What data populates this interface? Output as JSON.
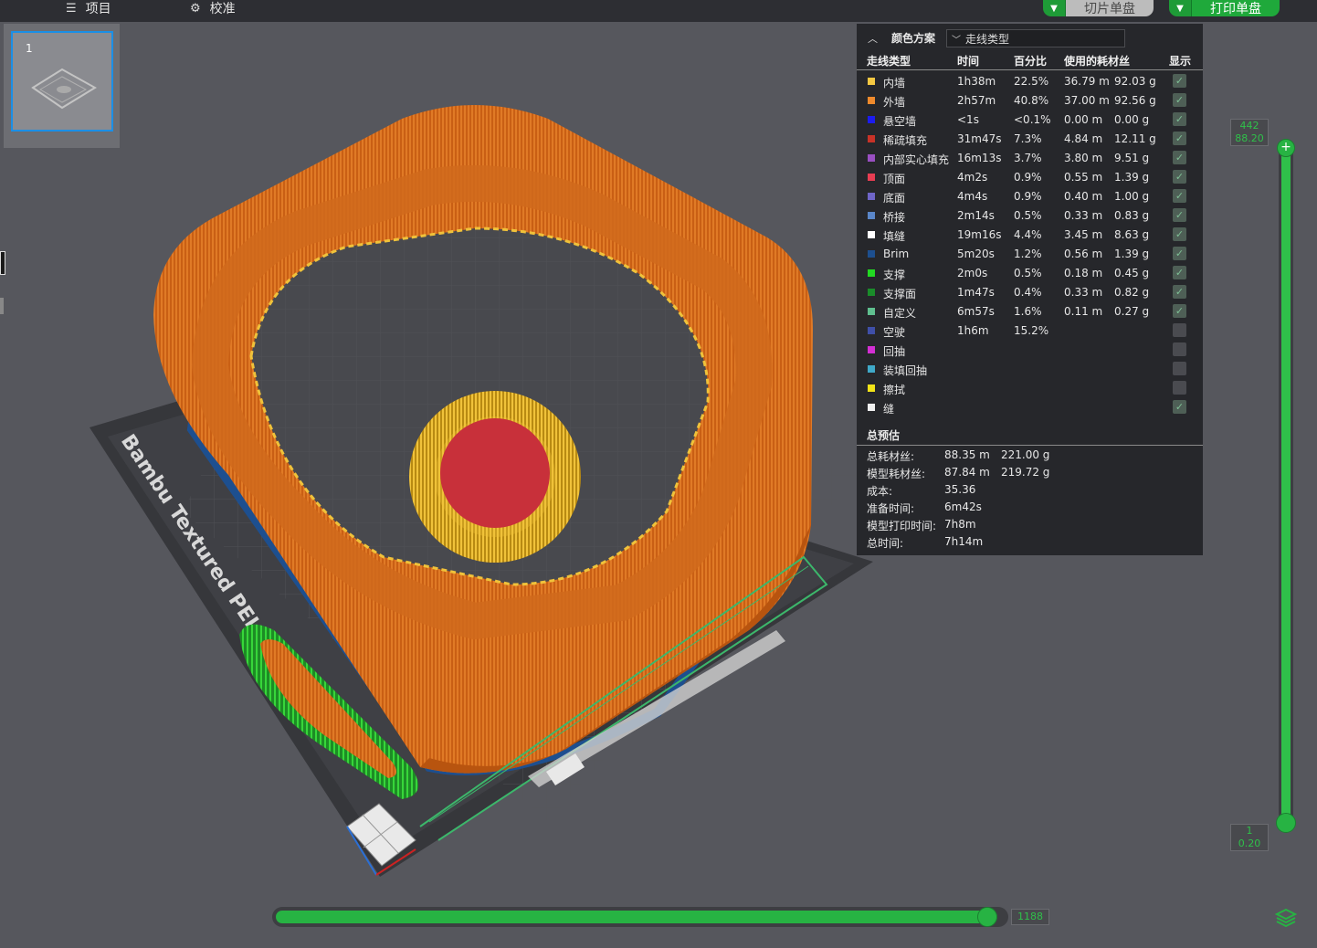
{
  "topbar": {
    "menu_project": "项目",
    "menu_calibrate": "校准",
    "slice_button": "切片单盘",
    "print_button": "打印单盘"
  },
  "plates": {
    "thumbnail_number": "1"
  },
  "bed": {
    "label": "Bambu Textured PEI Plat"
  },
  "legend": {
    "scheme_label": "颜色方案",
    "scheme_value": "走线类型",
    "headers": {
      "type": "走线类型",
      "time": "时间",
      "percent": "百分比",
      "filament": "使用的耗材丝",
      "display": "显示"
    },
    "rows": [
      {
        "name": "内墙",
        "color": "#f5c842",
        "time": "1h38m",
        "percent": "22.5%",
        "length": "36.79 m",
        "weight": "92.03 g",
        "shown": true
      },
      {
        "name": "外墙",
        "color": "#ef8a2c",
        "time": "2h57m",
        "percent": "40.8%",
        "length": "37.00 m",
        "weight": "92.56 g",
        "shown": true
      },
      {
        "name": "悬空墙",
        "color": "#1c1cf0",
        "time": "<1s",
        "percent": "<0.1%",
        "length": "0.00 m",
        "weight": "0.00 g",
        "shown": true
      },
      {
        "name": "稀疏填充",
        "color": "#c83227",
        "time": "31m47s",
        "percent": "7.3%",
        "length": "4.84 m",
        "weight": "12.11 g",
        "shown": true
      },
      {
        "name": "内部实心填充",
        "color": "#9a4fc2",
        "time": "16m13s",
        "percent": "3.7%",
        "length": "3.80 m",
        "weight": "9.51 g",
        "shown": true
      },
      {
        "name": "顶面",
        "color": "#e83d52",
        "time": "4m2s",
        "percent": "0.9%",
        "length": "0.55 m",
        "weight": "1.39 g",
        "shown": true
      },
      {
        "name": "底面",
        "color": "#6f65c8",
        "time": "4m4s",
        "percent": "0.9%",
        "length": "0.40 m",
        "weight": "1.00 g",
        "shown": true
      },
      {
        "name": "桥接",
        "color": "#5a86c9",
        "time": "2m14s",
        "percent": "0.5%",
        "length": "0.33 m",
        "weight": "0.83 g",
        "shown": true
      },
      {
        "name": "填缝",
        "color": "#ffffff",
        "time": "19m16s",
        "percent": "4.4%",
        "length": "3.45 m",
        "weight": "8.63 g",
        "shown": true
      },
      {
        "name": "Brim",
        "color": "#1d4f8f",
        "time": "5m20s",
        "percent": "1.2%",
        "length": "0.56 m",
        "weight": "1.39 g",
        "shown": true
      },
      {
        "name": "支撑",
        "color": "#22d922",
        "time": "2m0s",
        "percent": "0.5%",
        "length": "0.18 m",
        "weight": "0.45 g",
        "shown": true
      },
      {
        "name": "支撑面",
        "color": "#1a8c2a",
        "time": "1m47s",
        "percent": "0.4%",
        "length": "0.33 m",
        "weight": "0.82 g",
        "shown": true
      },
      {
        "name": "自定义",
        "color": "#5fbf8f",
        "time": "6m57s",
        "percent": "1.6%",
        "length": "0.11 m",
        "weight": "0.27 g",
        "shown": true
      },
      {
        "name": "空驶",
        "color": "#3f4fa8",
        "time": "1h6m",
        "percent": "15.2%",
        "length": "",
        "weight": "",
        "shown": false
      },
      {
        "name": "回抽",
        "color": "#d32fd3",
        "time": "",
        "percent": "",
        "length": "",
        "weight": "",
        "shown": false
      },
      {
        "name": "装填回抽",
        "color": "#3fa9c8",
        "time": "",
        "percent": "",
        "length": "",
        "weight": "",
        "shown": false
      },
      {
        "name": "擦拭",
        "color": "#f2e318",
        "time": "",
        "percent": "",
        "length": "",
        "weight": "",
        "shown": false
      },
      {
        "name": "缝",
        "color": "#f0f0f0",
        "time": "",
        "percent": "",
        "length": "",
        "weight": "",
        "shown": true
      }
    ],
    "summary_title": "总预估",
    "summary": [
      {
        "label": "总耗材丝:",
        "a": "88.35 m",
        "b": "221.00 g"
      },
      {
        "label": "模型耗材丝:",
        "a": "87.84 m",
        "b": "219.72 g"
      },
      {
        "label": "成本:",
        "a": "35.36",
        "b": ""
      },
      {
        "label": "准备时间:",
        "a": "6m42s",
        "b": ""
      },
      {
        "label": "模型打印时间:",
        "a": "7h8m",
        "b": ""
      },
      {
        "label": "总时间:",
        "a": "7h14m",
        "b": ""
      }
    ]
  },
  "layer_slider": {
    "top_layer": "442",
    "top_height": "88.20",
    "bottom_layer": "1",
    "bottom_height": "0.20"
  },
  "move_slider": {
    "value": "1188",
    "fraction": 0.985
  }
}
